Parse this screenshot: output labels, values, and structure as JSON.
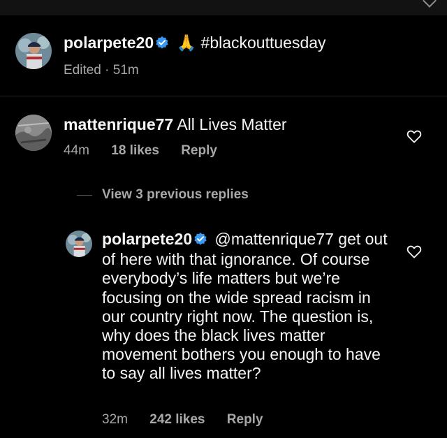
{
  "caption": {
    "username": "polarpete20",
    "emoji": "🙏",
    "text": "#blackouttuesday",
    "meta": "Edited · 51m"
  },
  "comment": {
    "username": "mattenrique77",
    "text": "All Lives Matter",
    "time": "44m",
    "likes": "18 likes",
    "reply_label": "Reply"
  },
  "view_replies": "View 3 previous replies",
  "reply": {
    "username": "polarpete20",
    "mention": "@mattenrique77",
    "text": "get out of here with that ignorance. Of course everybody’s life matters but we’re focusing on the wide spread racism in our country right now. The question is, why does the black lives matter movement bothers you enough to have to say all lives matter?",
    "time": "32m",
    "likes": "242 likes",
    "reply_label": "Reply"
  },
  "colors": {
    "background": "#000000",
    "text": "#f5f5f5",
    "secondary": "#a8a8a8",
    "verified": "#3897f0"
  }
}
